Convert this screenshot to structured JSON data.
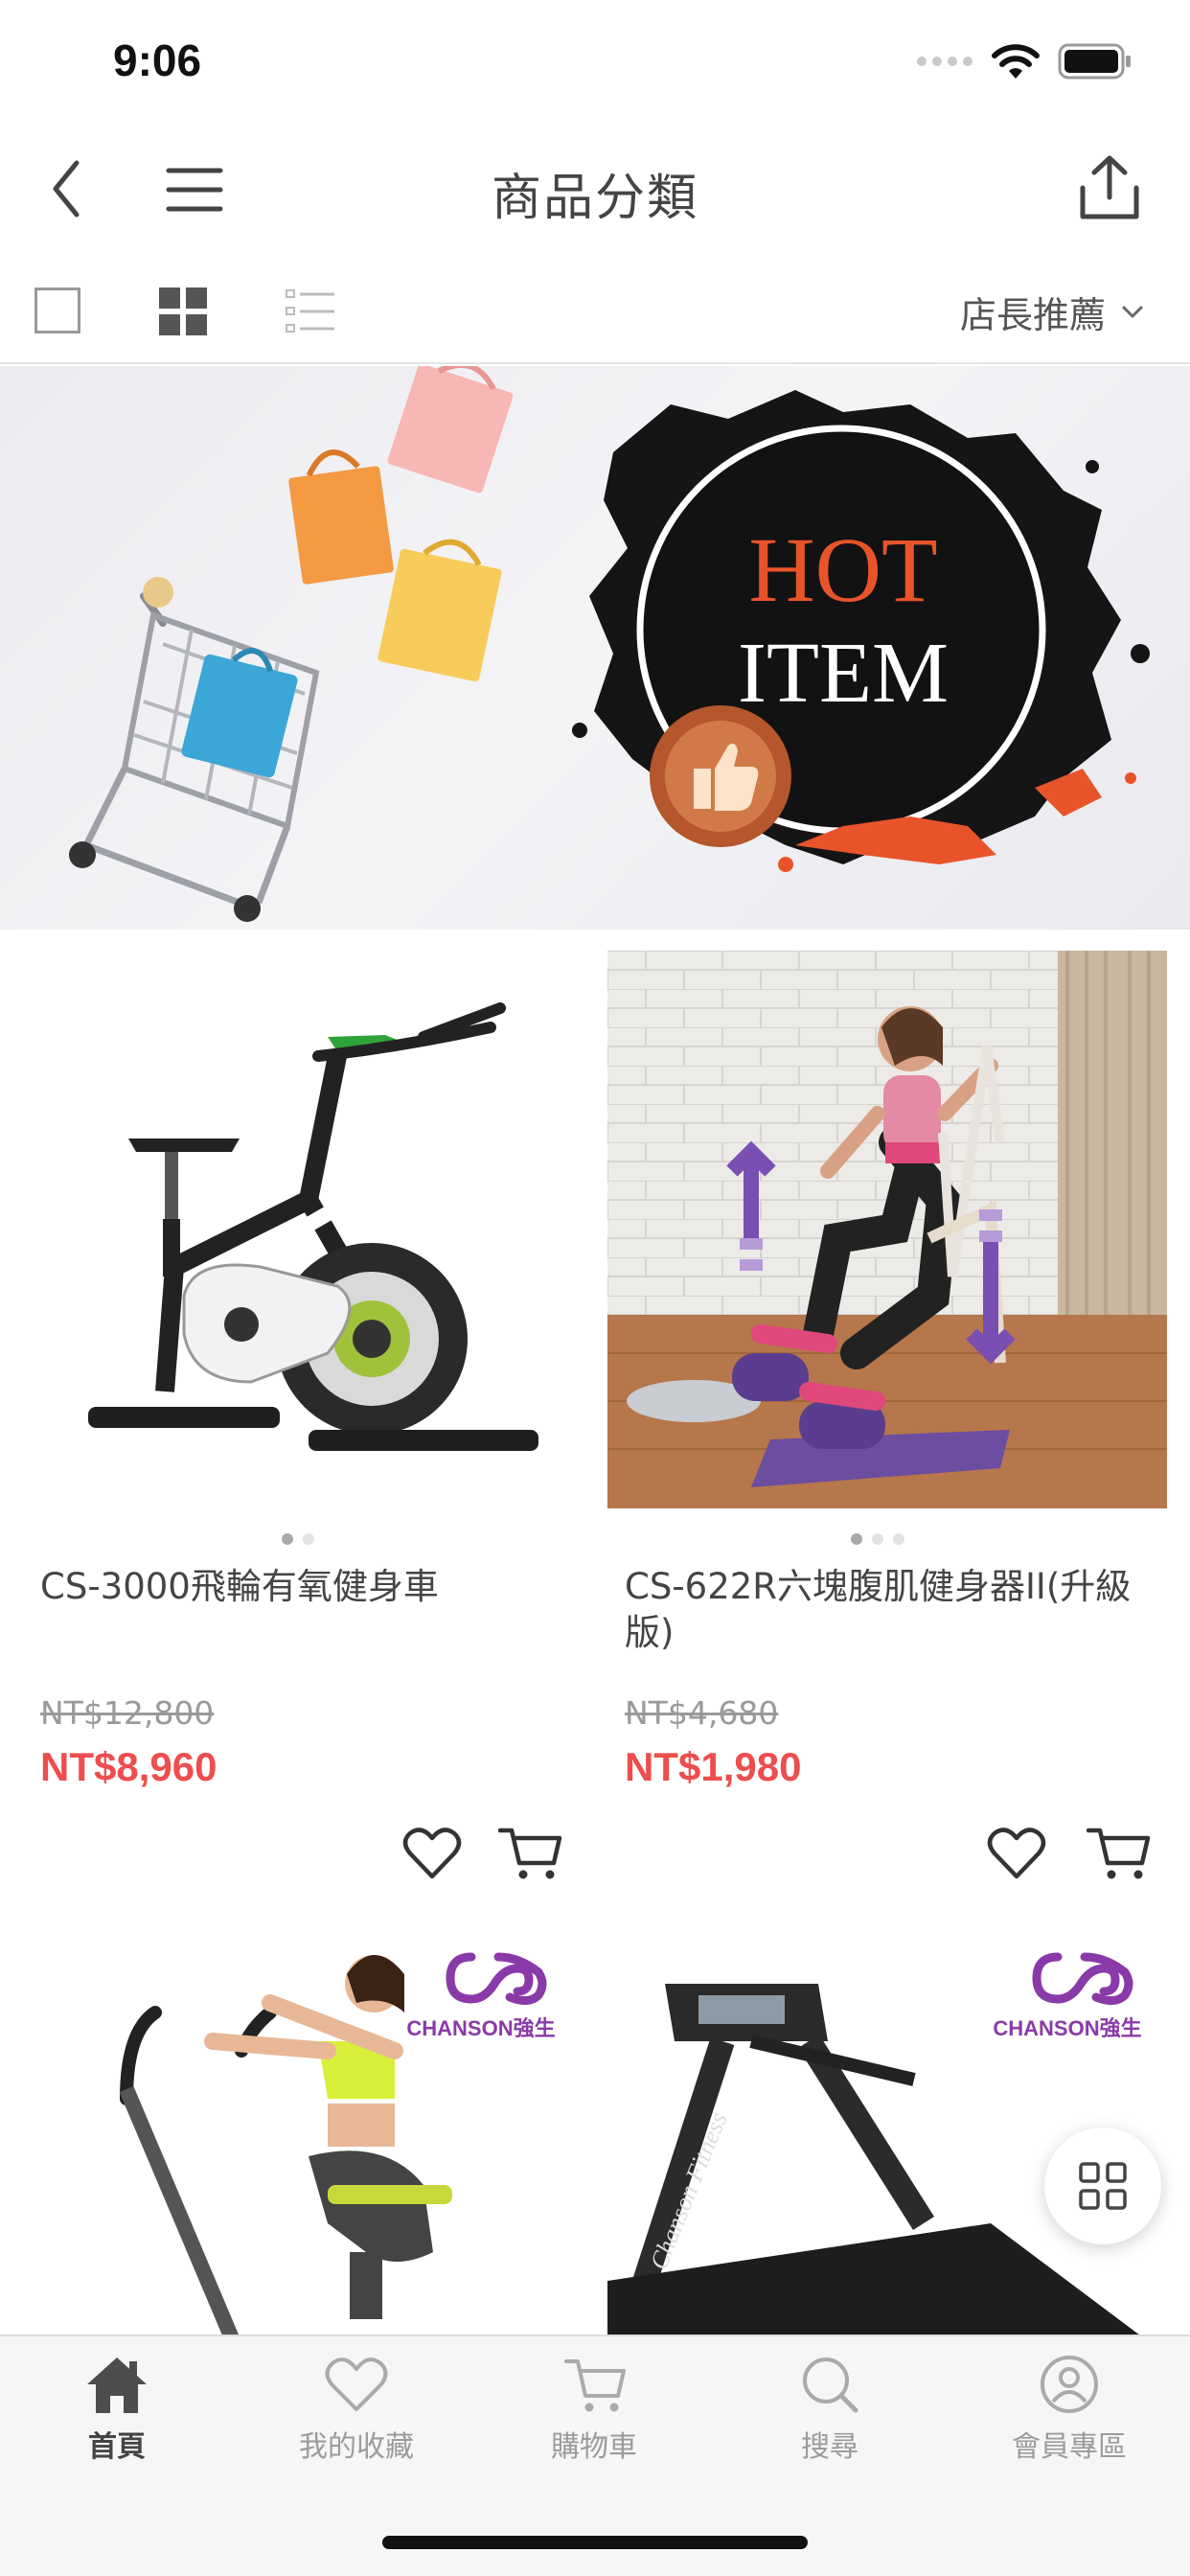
{
  "status_bar": {
    "time": "9:06"
  },
  "nav": {
    "title": "商品分類"
  },
  "toolbar": {
    "sort_label": "店長推薦"
  },
  "banner": {
    "line1": "HOT",
    "line2": "ITEM"
  },
  "products": [
    {
      "name": "CS-3000飛輪有氧健身車",
      "original_price": "NT$12,800",
      "sale_price": "NT$8,960",
      "image_count": 2,
      "active_image": 1
    },
    {
      "name": "CS-622R六塊腹肌健身器II(升級版)",
      "original_price": "NT$4,680",
      "sale_price": "NT$1,980",
      "image_count": 3,
      "active_image": 1
    },
    {
      "brand_logo": "CHANSON強生"
    },
    {
      "brand_logo": "CHANSON強生"
    }
  ],
  "tab_bar": {
    "items": [
      {
        "label": "首頁",
        "icon": "home-icon"
      },
      {
        "label": "我的收藏",
        "icon": "heart-icon"
      },
      {
        "label": "購物車",
        "icon": "cart-icon"
      },
      {
        "label": "搜尋",
        "icon": "search-icon"
      },
      {
        "label": "會員專區",
        "icon": "user-icon"
      }
    ],
    "active_index": 0
  },
  "colors": {
    "sale_price": "#ee4d4d",
    "banner_accent": "#e8542a",
    "brand_purple": "#8a3aa8"
  }
}
